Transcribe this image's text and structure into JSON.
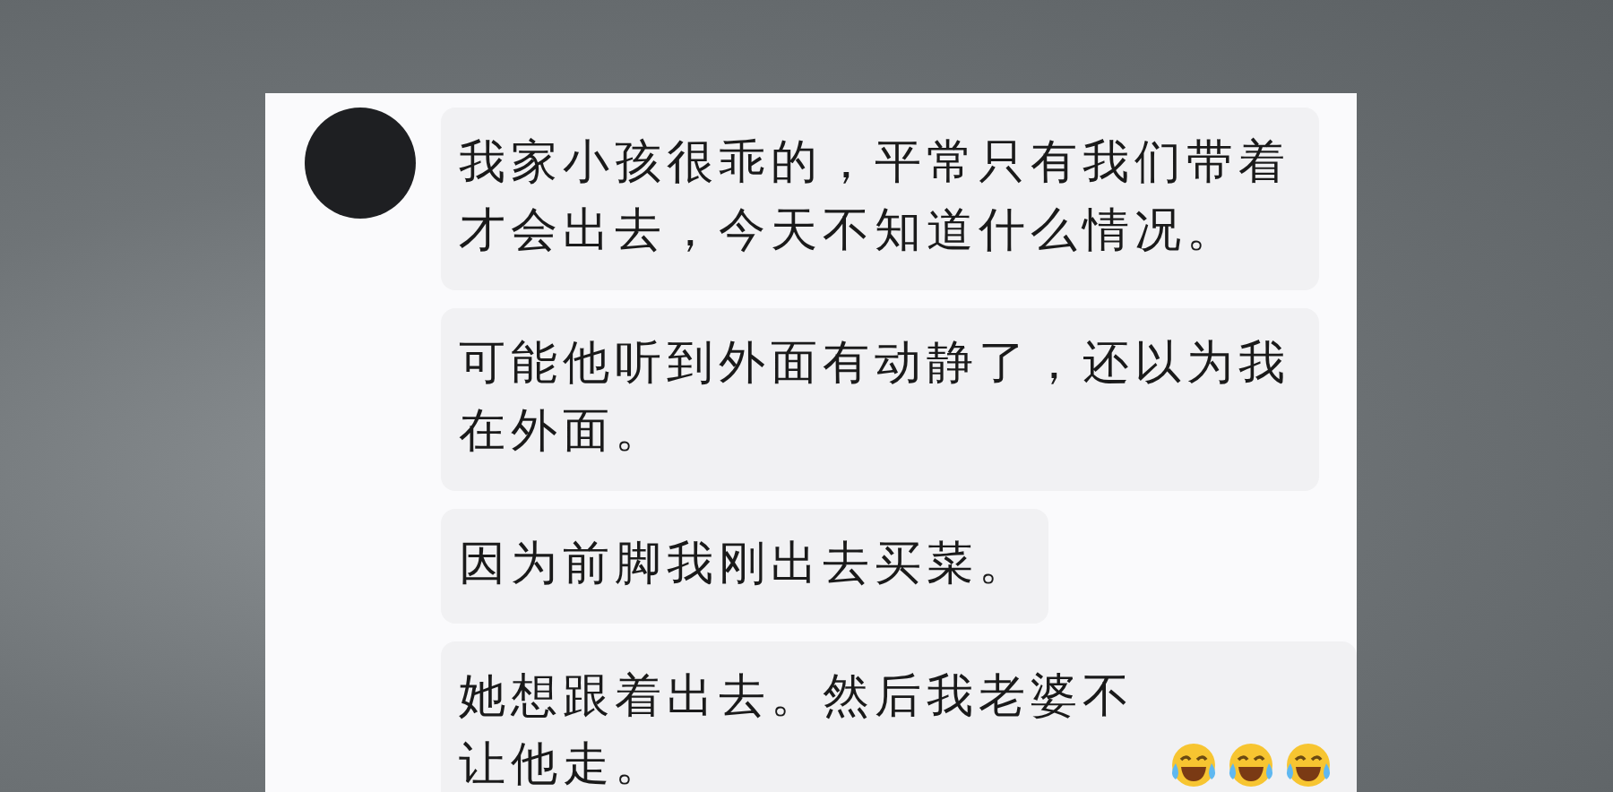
{
  "chat": {
    "messages": [
      {
        "text": "我家小孩很乖的，平常只有我们带着才会出去，今天不知道什么情况。",
        "show_avatar": true
      },
      {
        "text": "可能他听到外面有动静了，还以为我在外面。",
        "show_avatar": false
      },
      {
        "text": "因为前脚我刚出去买菜。",
        "show_avatar": false
      },
      {
        "text": "她想跟着出去。然后我老婆不让他走。",
        "show_avatar": false,
        "emoji": [
          {
            "kind": "laugh-cry"
          },
          {
            "kind": "laugh-cry"
          },
          {
            "kind": "laugh-cry"
          }
        ]
      }
    ]
  }
}
